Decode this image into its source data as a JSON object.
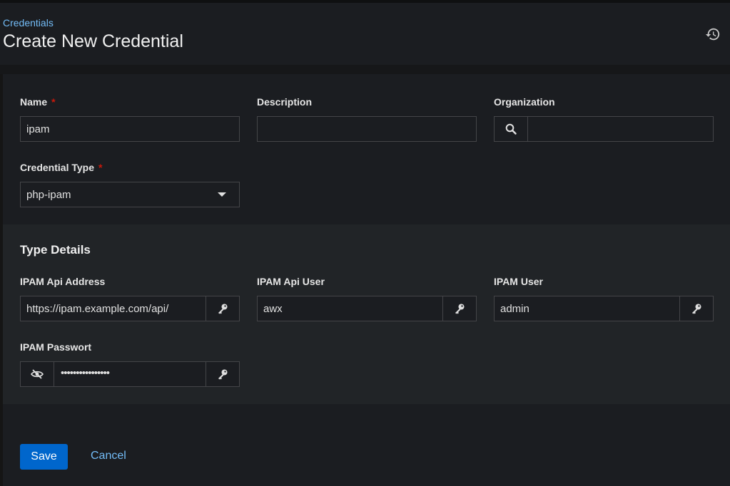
{
  "header": {
    "breadcrumb": "Credentials",
    "title": "Create New Credential",
    "history_icon": "history-icon"
  },
  "form": {
    "name": {
      "label": "Name",
      "required": "*",
      "value": "ipam"
    },
    "description": {
      "label": "Description",
      "value": ""
    },
    "organization": {
      "label": "Organization",
      "value": "",
      "icon": "search-icon"
    },
    "credential_type": {
      "label": "Credential Type",
      "required": "*",
      "value": "php-ipam"
    }
  },
  "type_details": {
    "title": "Type Details",
    "api_address": {
      "label": "IPAM Api Address",
      "value": "https://ipam.example.com/api/"
    },
    "api_user": {
      "label": "IPAM Api User",
      "value": "awx"
    },
    "user": {
      "label": "IPAM User",
      "value": "admin"
    },
    "password": {
      "label": "IPAM Passwort",
      "value": "••••••••••••••••"
    }
  },
  "actions": {
    "save": "Save",
    "cancel": "Cancel"
  },
  "colors": {
    "accent": "#0066cc",
    "link": "#73bcf7",
    "required": "#c9190b"
  }
}
